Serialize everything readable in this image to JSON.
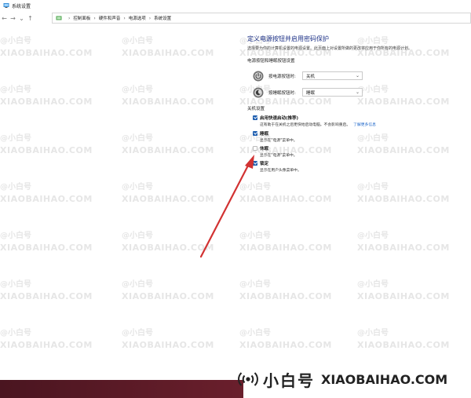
{
  "window": {
    "title": "系统设置"
  },
  "nav": {
    "back": "←",
    "forward": "→",
    "recent": "⌄",
    "up": "↑",
    "breadcrumbs": [
      "控制面板",
      "硬件和声音",
      "电源选项",
      "系统设置"
    ],
    "separator": "›"
  },
  "page": {
    "title": "定义电源按钮并启用密码保护",
    "description": "选择要为你的计算机设置的电源设置。此页面上对设置所做的更改将应用于你所有的电源计划。"
  },
  "power_buttons": {
    "heading": "电源按钮和睡眠按钮设置",
    "rows": [
      {
        "label": "按电源按钮时:",
        "value": "关机"
      },
      {
        "label": "按睡眠按钮时:",
        "value": "睡眠"
      }
    ]
  },
  "shutdown": {
    "heading": "关机设置",
    "options": [
      {
        "label": "启用快速启动(推荐)",
        "checked": true,
        "desc": "这有助于在关机之后更快地启动电脑。不会影响重启。",
        "link": "了解更多信息"
      },
      {
        "label": "睡眠",
        "checked": true,
        "desc": "显示在\"电源\"菜单中。"
      },
      {
        "label": "休眠",
        "checked": false,
        "desc": "显示在\"电源\"菜单中。"
      },
      {
        "label": "锁定",
        "checked": true,
        "desc": "显示在用户头像菜单中。"
      }
    ]
  },
  "watermark": {
    "cn": "@小白号",
    "en": "XIAOBAIHAO.COM"
  },
  "brand": {
    "cn": "小白号",
    "en": "XIAOBAIHAO.COM"
  },
  "colors": {
    "accent": "#1f5fb0",
    "title": "#1e3287",
    "arrow": "#d23232",
    "taskbar": "#5a1a26"
  }
}
